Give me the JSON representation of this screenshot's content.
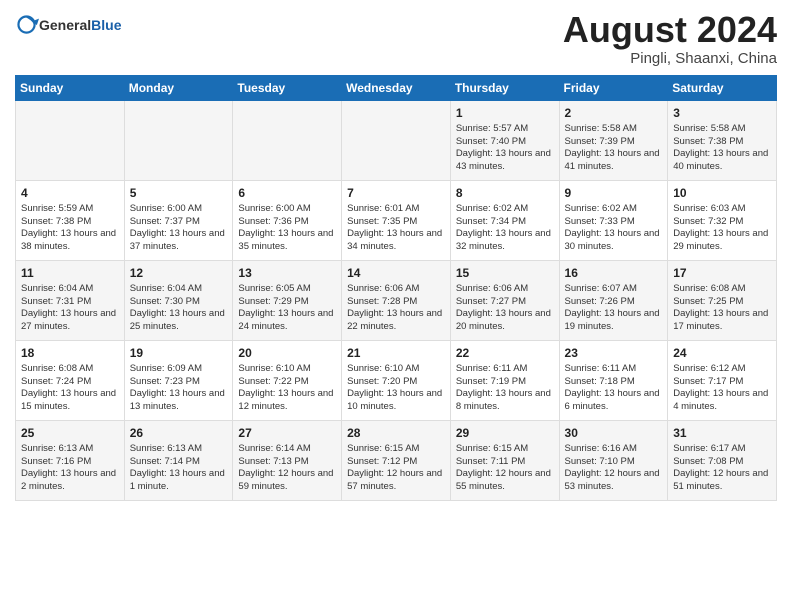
{
  "header": {
    "logo_general": "General",
    "logo_blue": "Blue",
    "month_year": "August 2024",
    "location": "Pingli, Shaanxi, China"
  },
  "days_of_week": [
    "Sunday",
    "Monday",
    "Tuesday",
    "Wednesday",
    "Thursday",
    "Friday",
    "Saturday"
  ],
  "weeks": [
    [
      {
        "day": "",
        "content": ""
      },
      {
        "day": "",
        "content": ""
      },
      {
        "day": "",
        "content": ""
      },
      {
        "day": "",
        "content": ""
      },
      {
        "day": "1",
        "sunrise": "Sunrise: 5:57 AM",
        "sunset": "Sunset: 7:40 PM",
        "daylight": "Daylight: 13 hours and 43 minutes."
      },
      {
        "day": "2",
        "sunrise": "Sunrise: 5:58 AM",
        "sunset": "Sunset: 7:39 PM",
        "daylight": "Daylight: 13 hours and 41 minutes."
      },
      {
        "day": "3",
        "sunrise": "Sunrise: 5:58 AM",
        "sunset": "Sunset: 7:38 PM",
        "daylight": "Daylight: 13 hours and 40 minutes."
      }
    ],
    [
      {
        "day": "4",
        "sunrise": "Sunrise: 5:59 AM",
        "sunset": "Sunset: 7:38 PM",
        "daylight": "Daylight: 13 hours and 38 minutes."
      },
      {
        "day": "5",
        "sunrise": "Sunrise: 6:00 AM",
        "sunset": "Sunset: 7:37 PM",
        "daylight": "Daylight: 13 hours and 37 minutes."
      },
      {
        "day": "6",
        "sunrise": "Sunrise: 6:00 AM",
        "sunset": "Sunset: 7:36 PM",
        "daylight": "Daylight: 13 hours and 35 minutes."
      },
      {
        "day": "7",
        "sunrise": "Sunrise: 6:01 AM",
        "sunset": "Sunset: 7:35 PM",
        "daylight": "Daylight: 13 hours and 34 minutes."
      },
      {
        "day": "8",
        "sunrise": "Sunrise: 6:02 AM",
        "sunset": "Sunset: 7:34 PM",
        "daylight": "Daylight: 13 hours and 32 minutes."
      },
      {
        "day": "9",
        "sunrise": "Sunrise: 6:02 AM",
        "sunset": "Sunset: 7:33 PM",
        "daylight": "Daylight: 13 hours and 30 minutes."
      },
      {
        "day": "10",
        "sunrise": "Sunrise: 6:03 AM",
        "sunset": "Sunset: 7:32 PM",
        "daylight": "Daylight: 13 hours and 29 minutes."
      }
    ],
    [
      {
        "day": "11",
        "sunrise": "Sunrise: 6:04 AM",
        "sunset": "Sunset: 7:31 PM",
        "daylight": "Daylight: 13 hours and 27 minutes."
      },
      {
        "day": "12",
        "sunrise": "Sunrise: 6:04 AM",
        "sunset": "Sunset: 7:30 PM",
        "daylight": "Daylight: 13 hours and 25 minutes."
      },
      {
        "day": "13",
        "sunrise": "Sunrise: 6:05 AM",
        "sunset": "Sunset: 7:29 PM",
        "daylight": "Daylight: 13 hours and 24 minutes."
      },
      {
        "day": "14",
        "sunrise": "Sunrise: 6:06 AM",
        "sunset": "Sunset: 7:28 PM",
        "daylight": "Daylight: 13 hours and 22 minutes."
      },
      {
        "day": "15",
        "sunrise": "Sunrise: 6:06 AM",
        "sunset": "Sunset: 7:27 PM",
        "daylight": "Daylight: 13 hours and 20 minutes."
      },
      {
        "day": "16",
        "sunrise": "Sunrise: 6:07 AM",
        "sunset": "Sunset: 7:26 PM",
        "daylight": "Daylight: 13 hours and 19 minutes."
      },
      {
        "day": "17",
        "sunrise": "Sunrise: 6:08 AM",
        "sunset": "Sunset: 7:25 PM",
        "daylight": "Daylight: 13 hours and 17 minutes."
      }
    ],
    [
      {
        "day": "18",
        "sunrise": "Sunrise: 6:08 AM",
        "sunset": "Sunset: 7:24 PM",
        "daylight": "Daylight: 13 hours and 15 minutes."
      },
      {
        "day": "19",
        "sunrise": "Sunrise: 6:09 AM",
        "sunset": "Sunset: 7:23 PM",
        "daylight": "Daylight: 13 hours and 13 minutes."
      },
      {
        "day": "20",
        "sunrise": "Sunrise: 6:10 AM",
        "sunset": "Sunset: 7:22 PM",
        "daylight": "Daylight: 13 hours and 12 minutes."
      },
      {
        "day": "21",
        "sunrise": "Sunrise: 6:10 AM",
        "sunset": "Sunset: 7:20 PM",
        "daylight": "Daylight: 13 hours and 10 minutes."
      },
      {
        "day": "22",
        "sunrise": "Sunrise: 6:11 AM",
        "sunset": "Sunset: 7:19 PM",
        "daylight": "Daylight: 13 hours and 8 minutes."
      },
      {
        "day": "23",
        "sunrise": "Sunrise: 6:11 AM",
        "sunset": "Sunset: 7:18 PM",
        "daylight": "Daylight: 13 hours and 6 minutes."
      },
      {
        "day": "24",
        "sunrise": "Sunrise: 6:12 AM",
        "sunset": "Sunset: 7:17 PM",
        "daylight": "Daylight: 13 hours and 4 minutes."
      }
    ],
    [
      {
        "day": "25",
        "sunrise": "Sunrise: 6:13 AM",
        "sunset": "Sunset: 7:16 PM",
        "daylight": "Daylight: 13 hours and 2 minutes."
      },
      {
        "day": "26",
        "sunrise": "Sunrise: 6:13 AM",
        "sunset": "Sunset: 7:14 PM",
        "daylight": "Daylight: 13 hours and 1 minute."
      },
      {
        "day": "27",
        "sunrise": "Sunrise: 6:14 AM",
        "sunset": "Sunset: 7:13 PM",
        "daylight": "Daylight: 12 hours and 59 minutes."
      },
      {
        "day": "28",
        "sunrise": "Sunrise: 6:15 AM",
        "sunset": "Sunset: 7:12 PM",
        "daylight": "Daylight: 12 hours and 57 minutes."
      },
      {
        "day": "29",
        "sunrise": "Sunrise: 6:15 AM",
        "sunset": "Sunset: 7:11 PM",
        "daylight": "Daylight: 12 hours and 55 minutes."
      },
      {
        "day": "30",
        "sunrise": "Sunrise: 6:16 AM",
        "sunset": "Sunset: 7:10 PM",
        "daylight": "Daylight: 12 hours and 53 minutes."
      },
      {
        "day": "31",
        "sunrise": "Sunrise: 6:17 AM",
        "sunset": "Sunset: 7:08 PM",
        "daylight": "Daylight: 12 hours and 51 minutes."
      }
    ]
  ]
}
